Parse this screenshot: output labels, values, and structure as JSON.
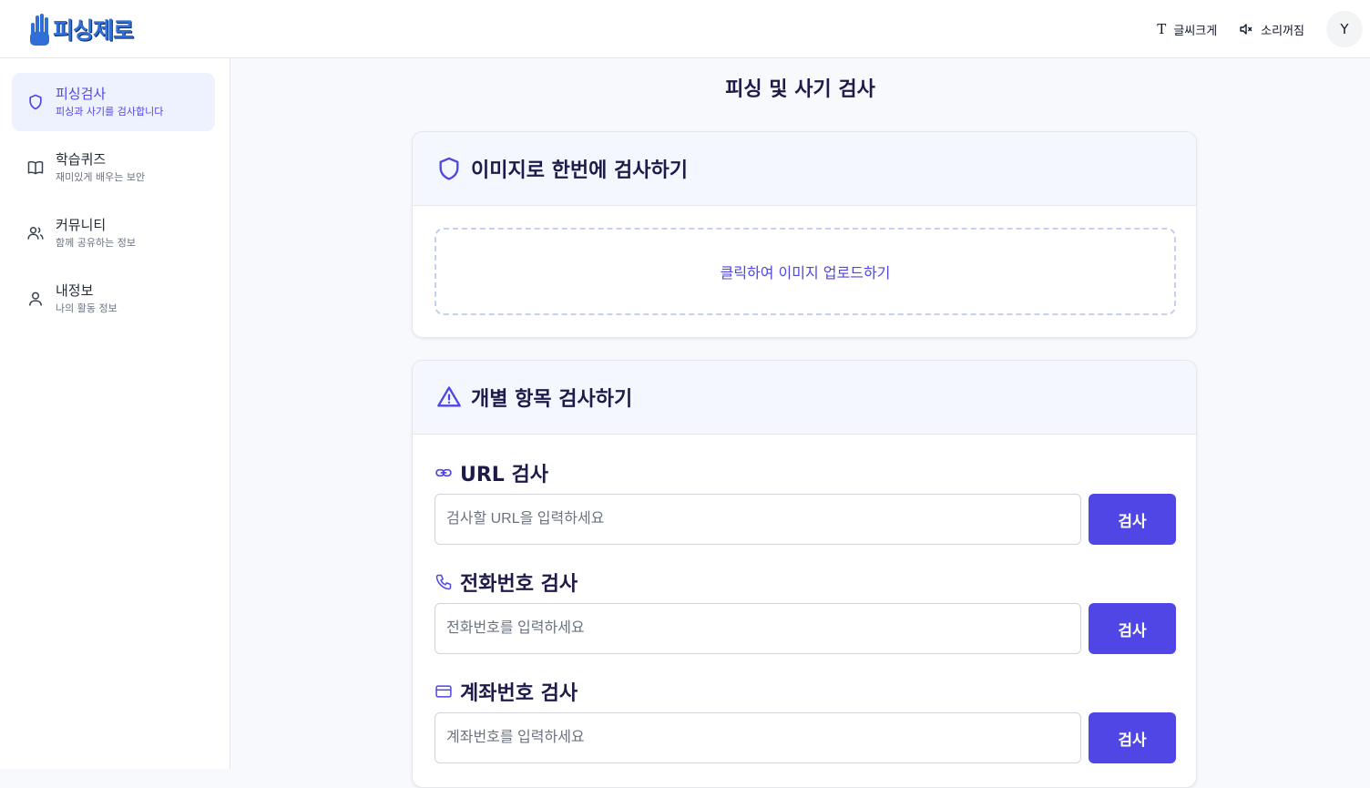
{
  "header": {
    "logo_text": "피싱제로",
    "font_size_label": "글씨크게",
    "sound_label": "소리꺼짐",
    "avatar_initial": "Y"
  },
  "sidebar": {
    "items": [
      {
        "title": "피싱검사",
        "subtitle": "피싱과 사기를 검사합니다",
        "icon": "shield-icon",
        "active": true
      },
      {
        "title": "학습퀴즈",
        "subtitle": "재미있게 배우는 보안",
        "icon": "book-icon",
        "active": false
      },
      {
        "title": "커뮤니티",
        "subtitle": "함께 공유하는 정보",
        "icon": "users-icon",
        "active": false
      },
      {
        "title": "내정보",
        "subtitle": "나의 활동 정보",
        "icon": "user-icon",
        "active": false
      }
    ]
  },
  "main": {
    "page_title": "피싱 및 사기 검사",
    "image_card": {
      "title": "이미지로 한번에 검사하기",
      "upload_text": "클릭하여 이미지 업로드하기"
    },
    "individual_card": {
      "title": "개별 항목 검사하기",
      "sections": [
        {
          "label": "URL 검사",
          "placeholder": "검사할 URL을 입력하세요",
          "button": "검사",
          "icon": "link-icon"
        },
        {
          "label": "전화번호 검사",
          "placeholder": "전화번호를 입력하세요",
          "button": "검사",
          "icon": "phone-icon"
        },
        {
          "label": "계좌번호 검사",
          "placeholder": "계좌번호를 입력하세요",
          "button": "검사",
          "icon": "credit-card-icon"
        }
      ]
    }
  },
  "colors": {
    "accent": "#4f46e5",
    "title": "#1e1b4b",
    "active_bg": "#eef2ff"
  }
}
